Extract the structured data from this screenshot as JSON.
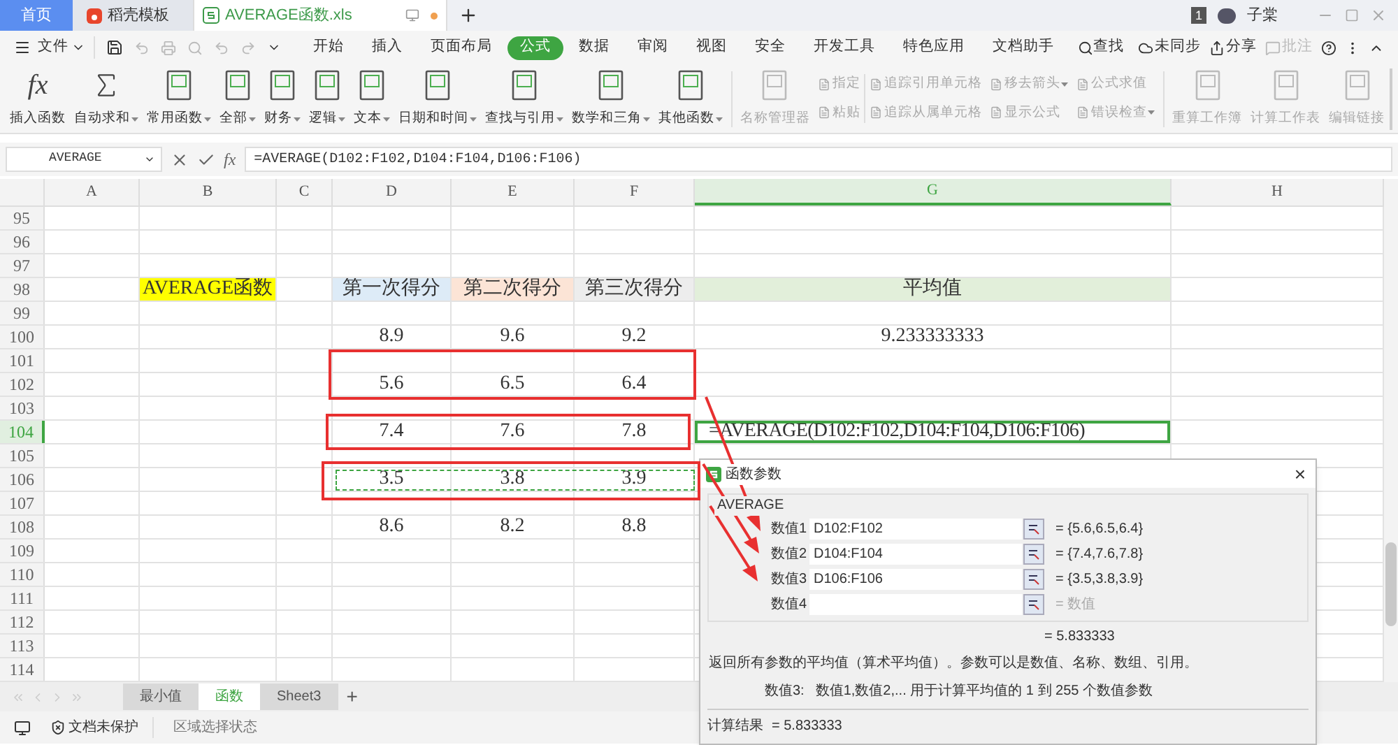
{
  "tabs": [
    {
      "label": "首页",
      "kind": "home",
      "selected": false
    },
    {
      "label": "稻壳模板",
      "kind": "docer",
      "selected": false
    },
    {
      "label": "AVERAGE函数.xls",
      "kind": "sheet",
      "selected": true
    }
  ],
  "account": {
    "badge": "1",
    "name": "子棠"
  },
  "menu": {
    "file": "文件",
    "items": [
      {
        "label": "开始",
        "selected": false
      },
      {
        "label": "插入",
        "selected": false
      },
      {
        "label": "页面布局",
        "selected": false
      },
      {
        "label": "公式",
        "selected": true
      },
      {
        "label": "数据",
        "selected": false
      },
      {
        "label": "审阅",
        "selected": false
      },
      {
        "label": "视图",
        "selected": false
      },
      {
        "label": "安全",
        "selected": false
      },
      {
        "label": "开发工具",
        "selected": false
      },
      {
        "label": "特色应用",
        "selected": false
      },
      {
        "label": "文档助手",
        "selected": false
      }
    ],
    "search": "查找",
    "sync": "未同步",
    "share": "分享",
    "comment": "批注"
  },
  "ribbon": [
    {
      "label": "插入函数",
      "kind": "fx",
      "glyph": "fx",
      "caret": false,
      "disabled": false
    },
    {
      "label": "自动求和",
      "kind": "sigma",
      "caret": true,
      "disabled": false
    },
    {
      "label": "常用函数",
      "kind": "book",
      "caret": true,
      "disabled": false
    },
    {
      "label": "全部",
      "kind": "book",
      "caret": true,
      "disabled": false
    },
    {
      "label": "财务",
      "kind": "book",
      "caret": true,
      "disabled": false
    },
    {
      "label": "逻辑",
      "kind": "book",
      "caret": true,
      "disabled": false
    },
    {
      "label": "文本",
      "kind": "book",
      "caret": true,
      "disabled": false
    },
    {
      "label": "日期和时间",
      "kind": "book",
      "caret": true,
      "disabled": false
    },
    {
      "label": "查找与引用",
      "kind": "book",
      "caret": true,
      "disabled": false
    },
    {
      "label": "数学和三角",
      "kind": "book",
      "caret": true,
      "disabled": false
    },
    {
      "label": "其他函数",
      "kind": "book",
      "caret": true,
      "disabled": false
    },
    {
      "label": "名称管理器",
      "kind": "book",
      "caret": false,
      "disabled": true
    }
  ],
  "ribbon_small": [
    [
      {
        "label": "指定",
        "caret": false,
        "disabled": true
      },
      {
        "label": "粘贴",
        "caret": false,
        "disabled": true
      }
    ],
    [
      {
        "label": "追踪引用单元格",
        "caret": false,
        "disabled": true
      },
      {
        "label": "追踪从属单元格",
        "caret": false,
        "disabled": true
      }
    ],
    [
      {
        "label": "移去箭头",
        "caret": true,
        "disabled": true
      },
      {
        "label": "显示公式",
        "caret": false,
        "disabled": true
      }
    ],
    [
      {
        "label": "公式求值",
        "caret": false,
        "disabled": true
      },
      {
        "label": "错误检查",
        "caret": true,
        "disabled": true
      }
    ]
  ],
  "ribbon_right": [
    {
      "label": "重算工作簿",
      "disabled": true
    },
    {
      "label": "计算工作表",
      "disabled": true
    },
    {
      "label": "编辑链接",
      "disabled": true
    }
  ],
  "formula_bar": {
    "name_box": "AVERAGE",
    "fx": "fx",
    "formula": "=AVERAGE(D102:F102,D104:F104,D106:F106)"
  },
  "columns": [
    {
      "label": "A",
      "selected": false
    },
    {
      "label": "B",
      "selected": false
    },
    {
      "label": "C",
      "selected": false
    },
    {
      "label": "D",
      "selected": false
    },
    {
      "label": "E",
      "selected": false
    },
    {
      "label": "F",
      "selected": false
    },
    {
      "label": "G",
      "selected": true
    },
    {
      "label": "H",
      "selected": false
    }
  ],
  "rows": [
    {
      "number": "95",
      "selected": false,
      "marquee": false
    },
    {
      "number": "96",
      "selected": false,
      "marquee": false
    },
    {
      "number": "97",
      "selected": false,
      "marquee": false
    },
    {
      "number": "98",
      "selected": false,
      "marquee": false,
      "cells": [
        {},
        {
          "text": "AVERAGE函数",
          "color": "#ffff00"
        },
        {},
        {
          "text": "第一次得分",
          "color": "#ddebf7"
        },
        {
          "text": "第二次得分",
          "color": "#fce4d6"
        },
        {
          "text": "第三次得分",
          "color": "#ededed"
        },
        {
          "text": "平均值",
          "color": "#e2efda"
        },
        {}
      ]
    },
    {
      "number": "99",
      "selected": false,
      "marquee": false
    },
    {
      "number": "100",
      "selected": false,
      "marquee": false,
      "cells": [
        {},
        {},
        {},
        {
          "text": "8.9"
        },
        {
          "text": "9.6"
        },
        {
          "text": "9.2"
        },
        {
          "text": "9.233333333"
        },
        {}
      ]
    },
    {
      "number": "101",
      "selected": false,
      "marquee": false
    },
    {
      "number": "102",
      "selected": false,
      "marquee": false,
      "cells": [
        {},
        {},
        {},
        {
          "text": "5.6"
        },
        {
          "text": "6.5"
        },
        {
          "text": "6.4"
        },
        {},
        {}
      ]
    },
    {
      "number": "103",
      "selected": false,
      "marquee": false
    },
    {
      "number": "104",
      "selected": true,
      "marquee": false,
      "cells": [
        {},
        {},
        {},
        {
          "text": "7.4"
        },
        {
          "text": "7.6"
        },
        {
          "text": "7.8"
        },
        {
          "text": "=AVERAGE(D102:F102,D104:F104,D106:F106)",
          "active": true
        },
        {}
      ]
    },
    {
      "number": "105",
      "selected": false,
      "marquee": false
    },
    {
      "number": "106",
      "selected": false,
      "marquee": true,
      "cells": [
        {},
        {},
        {},
        {
          "text": "3.5"
        },
        {
          "text": "3.8"
        },
        {
          "text": "3.9"
        },
        {},
        {}
      ]
    },
    {
      "number": "107",
      "selected": false,
      "marquee": false
    },
    {
      "number": "108",
      "selected": false,
      "marquee": false,
      "cells": [
        {},
        {},
        {},
        {
          "text": "8.6"
        },
        {
          "text": "8.2"
        },
        {
          "text": "8.8"
        },
        {},
        {}
      ]
    },
    {
      "number": "109",
      "selected": false,
      "marquee": false
    },
    {
      "number": "110",
      "selected": false,
      "marquee": false
    },
    {
      "number": "111",
      "selected": false,
      "marquee": false
    },
    {
      "number": "112",
      "selected": false,
      "marquee": false
    },
    {
      "number": "113",
      "selected": false,
      "marquee": false
    },
    {
      "number": "114",
      "selected": false,
      "marquee": false
    }
  ],
  "sheets": [
    {
      "label": "最小值",
      "selected": false
    },
    {
      "label": "函数",
      "selected": true
    },
    {
      "label": "Sheet3",
      "selected": false
    }
  ],
  "add_sheet": "+",
  "status_bar": {
    "protection": "文档未保护",
    "mode": "区域选择状态"
  },
  "dialog": {
    "title": "函数参数",
    "close": "×",
    "function": "AVERAGE",
    "args": [
      {
        "label": "数值1",
        "value": "D102:F102",
        "result": "= {5.6,6.5,6.4}",
        "hint": false
      },
      {
        "label": "数值2",
        "value": "D104:F104",
        "result": "= {7.4,7.6,7.8}",
        "hint": false
      },
      {
        "label": "数值3",
        "value": "D106:F106",
        "result": "= {3.5,3.8,3.9}",
        "hint": false
      },
      {
        "label": "数值4",
        "result": "= 数值",
        "hint": true
      }
    ],
    "total": "= 5.833333",
    "description": "返回所有参数的平均值（算术平均值）。参数可以是数值、名称、数组、引用。",
    "help_label": "数值3:",
    "help": "数值1,数值2,... 用于计算平均值的 1 到 255 个数值参数",
    "result_label": "计算结果",
    "result": "= 5.833333"
  }
}
